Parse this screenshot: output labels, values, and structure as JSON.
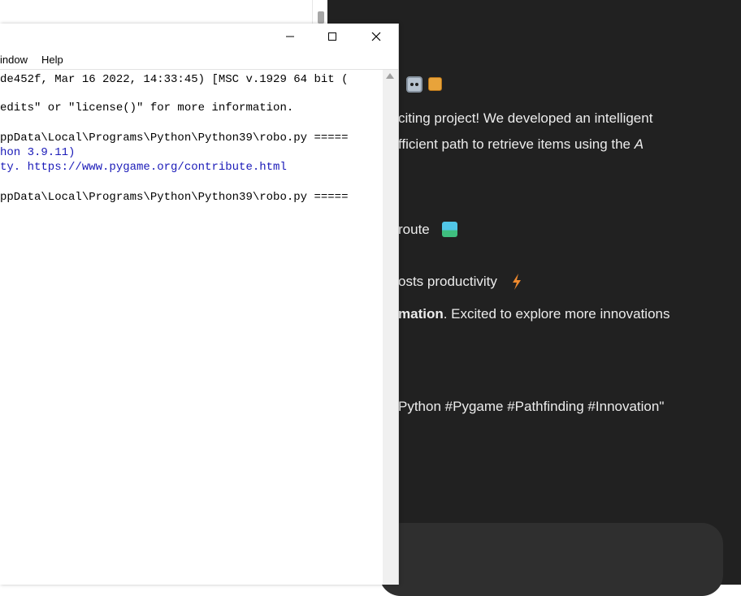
{
  "shell": {
    "menu": [
      "indow",
      "Help"
    ],
    "window_controls": {
      "minimize_icon": "minimize-icon",
      "maximize_icon": "maximize-icon",
      "close_icon": "close-icon"
    },
    "lines": [
      "de452f, Mar 16 2022, 14:33:45) [MSC v.1929 64 bit (",
      "edits\" or \"license()\" for more information.",
      "ppData\\Local\\Programs\\Python\\Python39\\robo.py =====",
      "hon 3.9.11)",
      "ty. https://www.pygame.org/contribute.html",
      "ppData\\Local\\Programs\\Python\\Python39\\robo.py ====="
    ]
  },
  "chat": {
    "line1": "citing project! We developed an intelligent",
    "line2_pre": "fficient path to retrieve items using the ",
    "line2_it": "A",
    "route": "route",
    "productivity": "osts productivity",
    "automation_bold": "mation",
    "automation_rest": ". Excited to explore more innovations",
    "hashtags": "Python #Pygame #Pathfinding #Innovation\"",
    "icons": [
      "robot-emoji-icon",
      "package-emoji-icon",
      "map-emoji-icon",
      "lightning-emoji-icon"
    ]
  },
  "colors": {
    "chat_bg": "#212121",
    "chat_text": "#ececec",
    "shell_output_blue": "#1a1ab8"
  }
}
